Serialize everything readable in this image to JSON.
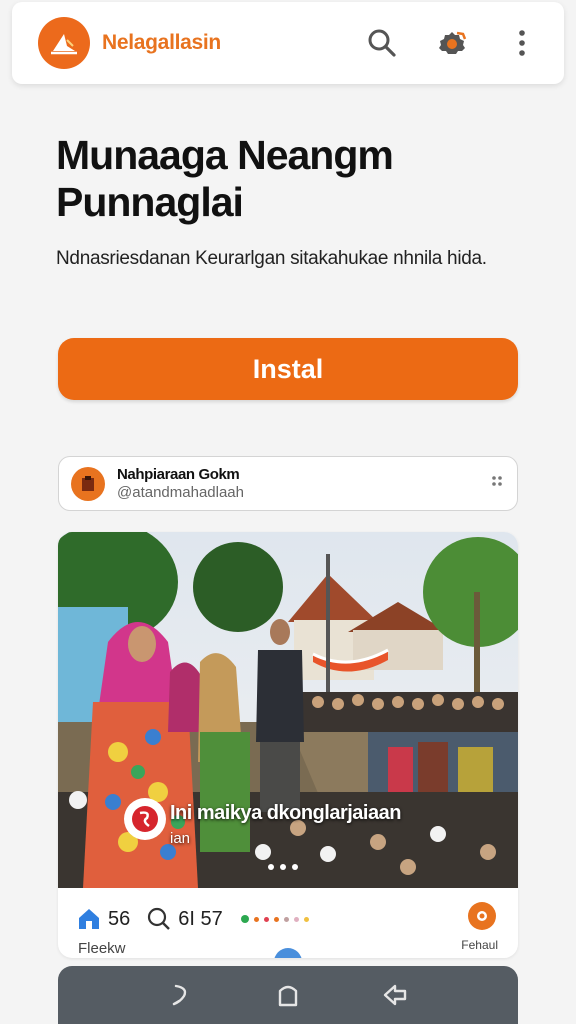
{
  "header": {
    "brand": "Nelagallasin",
    "icons": [
      "logo-icon",
      "search-icon",
      "gear-icon",
      "more-vertical-icon"
    ],
    "accent_color": "#e8731f"
  },
  "hero": {
    "title": "Munaaga Neangm Punnaglai",
    "subtitle": "Ndnasriesdanan Keurarlgan sitakahukae nhnila hida.",
    "install_label": "Instal",
    "install_color": "#ec6a14"
  },
  "profile": {
    "name": "Nahpiaraan Gokm",
    "handle": "@atandmahadlaah"
  },
  "post": {
    "caption": "Ini maikya dkonglarjaiaan",
    "caption_sub": "ian",
    "likes": "56",
    "comments": "6I 57",
    "footer_left": "Fleekw",
    "footer_right": "Fehaul"
  },
  "navigation": {
    "icons": [
      "back-gesture-icon",
      "home-icon",
      "recent-apps-icon"
    ]
  }
}
